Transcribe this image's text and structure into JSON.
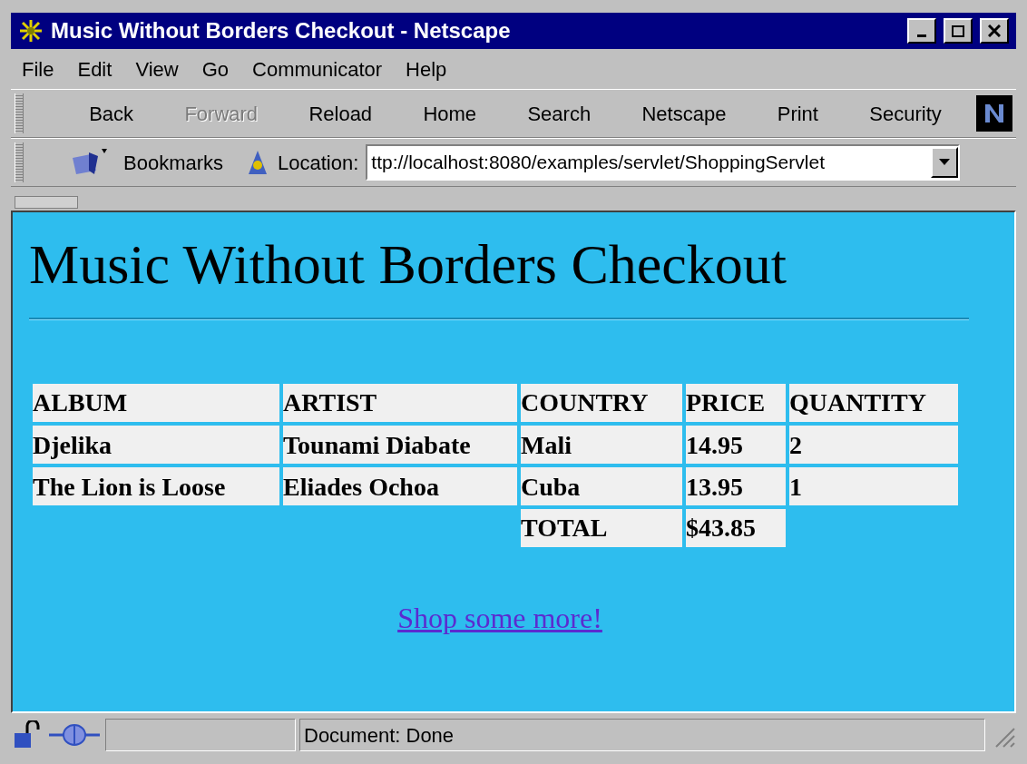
{
  "window": {
    "title": "Music Without Borders Checkout - Netscape"
  },
  "menu": [
    "File",
    "Edit",
    "View",
    "Go",
    "Communicator",
    "Help"
  ],
  "toolbar": [
    {
      "label": "Back",
      "disabled": false
    },
    {
      "label": "Forward",
      "disabled": true
    },
    {
      "label": "Reload",
      "disabled": false
    },
    {
      "label": "Home",
      "disabled": false
    },
    {
      "label": "Search",
      "disabled": false
    },
    {
      "label": "Netscape",
      "disabled": false
    },
    {
      "label": "Print",
      "disabled": false
    },
    {
      "label": "Security",
      "disabled": false
    }
  ],
  "location_bar": {
    "bookmarks": "Bookmarks",
    "label": "Location:",
    "value": "ttp://localhost:8080/examples/servlet/ShoppingServlet"
  },
  "page": {
    "heading": "Music Without Borders Checkout",
    "table": {
      "columns": [
        "ALBUM",
        "ARTIST",
        "COUNTRY",
        "PRICE",
        "QUANTITY"
      ],
      "rows": [
        [
          "Djelika",
          "Tounami Diabate",
          "Mali",
          "14.95",
          "2"
        ],
        [
          "The Lion is Loose",
          "Eliades Ochoa",
          "Cuba",
          "13.95",
          "1"
        ]
      ],
      "total": {
        "label": "TOTAL",
        "value": "$43.85"
      }
    },
    "link": "Shop some more!"
  },
  "status_bar": {
    "text": "Document: Done"
  }
}
